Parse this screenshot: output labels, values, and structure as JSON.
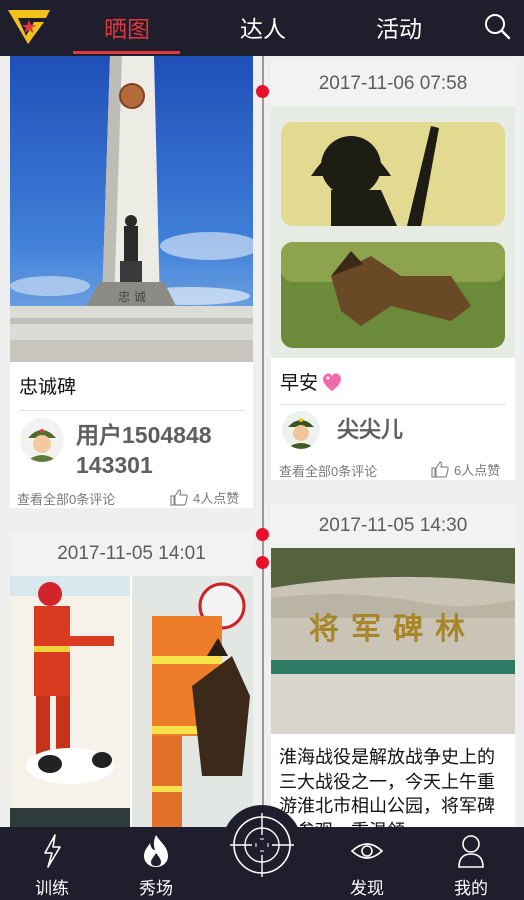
{
  "header": {
    "tabs": [
      {
        "label": "晒图",
        "active": true
      },
      {
        "label": "达人",
        "active": false
      },
      {
        "label": "活动",
        "active": false
      }
    ],
    "accent_color": "#e0383e"
  },
  "feed": {
    "left": [
      {
        "caption": "忠诚碑",
        "user": "用户1504848143301",
        "user_line1": "用户1504848",
        "user_line2": "143301",
        "comments": "查看全部0条评论",
        "likes": "4人点赞"
      },
      {
        "date": "2017-11-05  14:01"
      }
    ],
    "right": [
      {
        "date": "2017-11-06  07:58",
        "caption": "早安",
        "caption_emoji": "heart-sparkle",
        "user": "尖尖儿",
        "comments": "查看全部0条评论",
        "likes": "6人点赞"
      },
      {
        "date": "2017-11-05  14:30",
        "sign_text": "将军碑林",
        "text": "淮海战役是解放战争史上的三大战役之一，今天上午重游淮北市相山公园，将军碑林参观，重温领"
      }
    ]
  },
  "bottom_nav": [
    {
      "label": "训练",
      "icon": "lightning-icon"
    },
    {
      "label": "秀场",
      "icon": "flame-icon"
    },
    {
      "label": "",
      "icon": "crosshair-icon"
    },
    {
      "label": "发现",
      "icon": "eye-icon"
    },
    {
      "label": "我的",
      "icon": "person-icon"
    }
  ],
  "colors": {
    "bar_bg": "#1e1e2c",
    "timeline_dot": "#e8102a"
  }
}
